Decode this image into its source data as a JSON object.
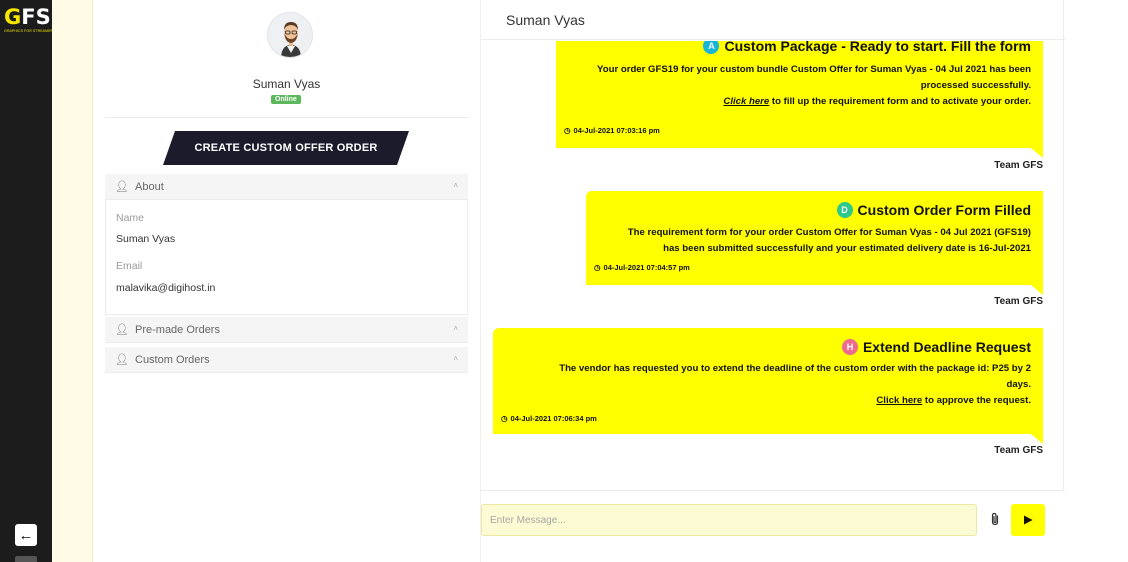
{
  "logo": {
    "g": "G",
    "rest": "FS",
    "tagline": "GRAPHICS FOR STREAMERS"
  },
  "rail": {
    "back_icon": "arrow-left-icon"
  },
  "profile": {
    "name": "Suman Vyas",
    "status": "Online",
    "create_button": "CREATE CUSTOM OFFER ORDER",
    "sections": {
      "about": "About",
      "premade": "Pre-made Orders",
      "custom": "Custom Orders"
    },
    "about": {
      "name_label": "Name",
      "name_value": "Suman Vyas",
      "email_label": "Email",
      "email_value": "malavika@digihost.in"
    }
  },
  "chat": {
    "header_title": "Suman Vyas",
    "messages": [
      {
        "icon_letter": "A",
        "icon_color": "#17b6d8",
        "title": "Custom Package - Ready to start. Fill the form",
        "line1": "Your order GFS19 for your custom bundle Custom Offer for Suman Vyas - 04 Jul 2021 has been",
        "line2": "processed successfully.",
        "link": "Click here",
        "line3": " to fill up the requirement form and to activate your order.",
        "time": "04-Jul-2021 07:03:16 pm",
        "sender": "Team GFS"
      },
      {
        "icon_letter": "D",
        "icon_color": "#2dc98a",
        "title": "Custom Order Form Filled",
        "line1": "The requirement form for your order Custom Offer for Suman Vyas - 04 Jul 2021 (GFS19)",
        "line2": "has been submitted successfully and your estimated delivery date is 16-Jul-2021",
        "time": "04-Jul-2021 07:04:57 pm",
        "sender": "Team GFS"
      },
      {
        "icon_letter": "H",
        "icon_color": "#ee6b8f",
        "title": "Extend Deadline Request",
        "line1": "The vendor has requested you to extend the deadline of the custom order with the package id: P25 by 2",
        "line2": "days.",
        "link": "Click here",
        "line3": " to approve the request.",
        "time": "04-Jul-2021 07:06:34 pm",
        "sender": "Team GFS"
      }
    ],
    "input_placeholder": "Enter Message...",
    "attach_icon": "paperclip-icon",
    "send_icon": "send-triangle-icon"
  },
  "colors": {
    "accent": "#ffff00",
    "rail": "#1c1c1c",
    "online": "#5cb85c",
    "button_dark": "#1b1b2b"
  }
}
